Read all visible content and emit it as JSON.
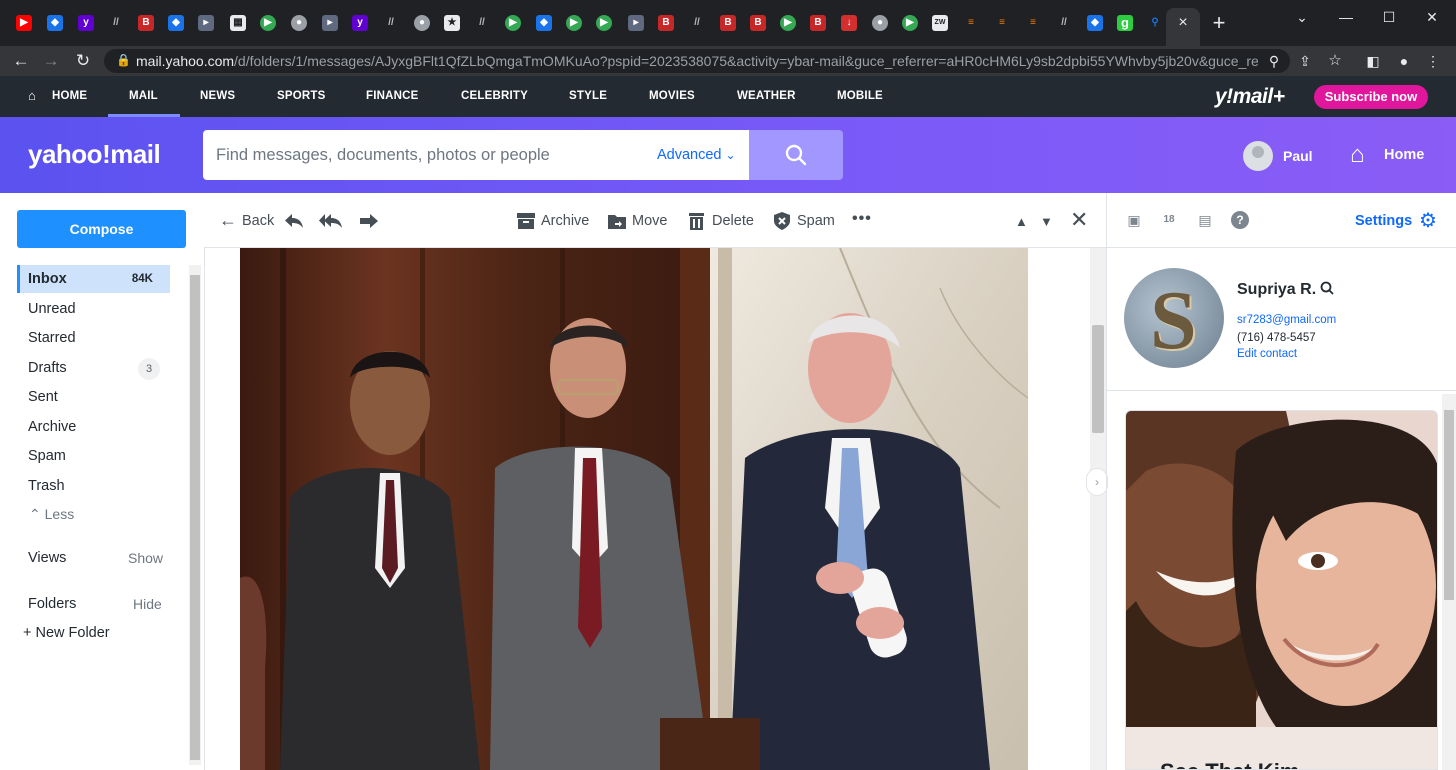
{
  "browser": {
    "url_main": "mail.yahoo.com",
    "url_rest": "/d/folders/1/messages/AJyxgBFlt1QfZLbQmgaTmOMKuAo?pspid=2023538075&activity=ybar-mail&guce_referrer=aHR0cHM6Ly9sb2dpbi55YWhvby5jb20v&guce_referrer_s...",
    "tab_close": "×",
    "new_tab": "+"
  },
  "ynav": {
    "items": [
      "HOME",
      "MAIL",
      "NEWS",
      "SPORTS",
      "FINANCE",
      "CELEBRITY",
      "STYLE",
      "MOVIES",
      "WEATHER",
      "MOBILE"
    ],
    "logo_plus": "y!mail+",
    "subscribe": "Subscribe now"
  },
  "header": {
    "logo": "yahoo!mail",
    "search_placeholder": "Find messages, documents, photos or people",
    "advanced": "Advanced",
    "user_name": "Paul",
    "home_label": "Home"
  },
  "sidebar": {
    "compose": "Compose",
    "folders": [
      {
        "label": "Inbox",
        "count": "84K"
      },
      {
        "label": "Unread",
        "count": ""
      },
      {
        "label": "Starred",
        "count": ""
      },
      {
        "label": "Drafts",
        "count": "3"
      },
      {
        "label": "Sent",
        "count": ""
      },
      {
        "label": "Archive",
        "count": ""
      },
      {
        "label": "Spam",
        "count": ""
      },
      {
        "label": "Trash",
        "count": ""
      }
    ],
    "less": "Less",
    "views": "Views",
    "views_action": "Show",
    "folders_label": "Folders",
    "folders_action": "Hide",
    "new_folder": "New Folder"
  },
  "toolbar": {
    "back": "Back",
    "archive": "Archive",
    "move": "Move",
    "delete": "Delete",
    "spam": "Spam",
    "more": "•••"
  },
  "right_pane": {
    "settings": "Settings",
    "contact": {
      "initial": "S",
      "name": "Supriya R.",
      "email": "sr7283@gmail.com",
      "phone": "(716) 478-5457",
      "edit": "Edit contact"
    },
    "ad_caption": "See That Kim..."
  },
  "colors": {
    "nav_bg": "#232a31",
    "header_purple": "#6d56f5",
    "compose_blue": "#1e90ff",
    "subscribe_pink": "#e0169c",
    "link_blue": "#0f69ff"
  },
  "icons": [
    "back-arrow-icon",
    "reply-icon",
    "reply-all-icon",
    "forward-icon",
    "archive-icon",
    "move-icon",
    "delete-icon",
    "spam-icon",
    "search-icon",
    "gear-icon",
    "home-icon",
    "contacts-icon",
    "calendar-icon",
    "notepad-icon",
    "help-icon"
  ]
}
